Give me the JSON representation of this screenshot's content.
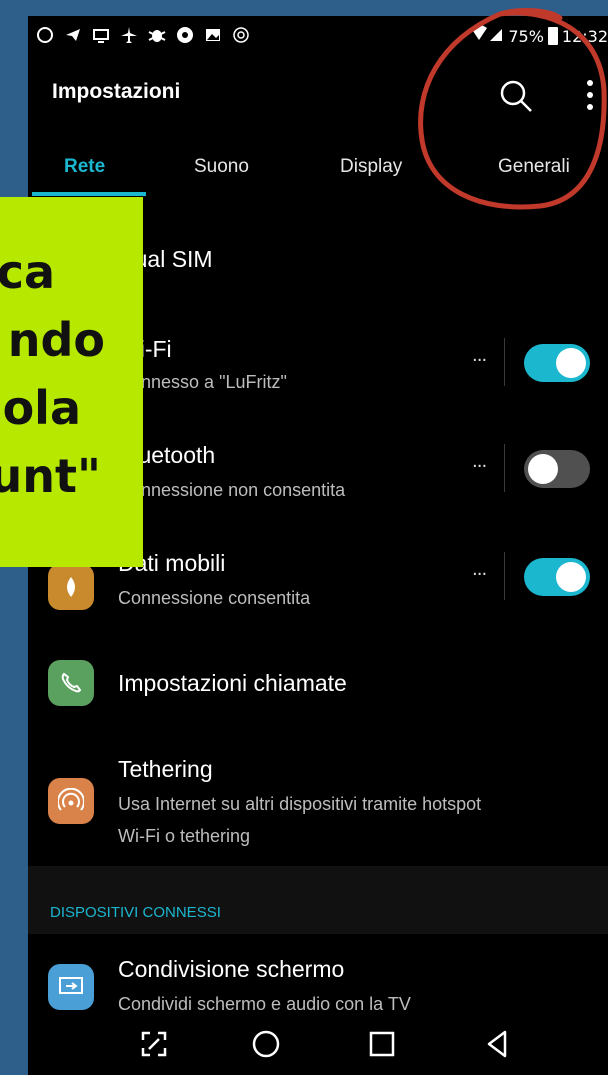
{
  "status_bar": {
    "left_icons": [
      "whatsapp-icon",
      "telegram-icon",
      "tv-icon",
      "airplane-icon",
      "bug-icon",
      "shield-icon",
      "image-icon",
      "at-icon"
    ],
    "battery": "75%",
    "time": "12:32"
  },
  "app_bar": {
    "title": "Impostazioni"
  },
  "tabs": [
    {
      "label": "Rete",
      "active": true
    },
    {
      "label": "Suono"
    },
    {
      "label": "Display"
    },
    {
      "label": "Generali"
    }
  ],
  "rows": {
    "dual_sim": {
      "title": "Dual SIM"
    },
    "wifi": {
      "title": "Wi-Fi",
      "subtitle": "Connesso a \"LuFritz\"",
      "toggle": "on"
    },
    "bluetooth": {
      "title": "Bluetooth",
      "subtitle": "Connessione non consentita",
      "toggle": "off"
    },
    "dati_mobili": {
      "title": "Dati mobili",
      "subtitle": "Connessione consentita",
      "toggle": "on"
    },
    "chiamate": {
      "title": "Impostazioni chiamate"
    },
    "tethering": {
      "title": "Tethering",
      "subtitle_1": "Usa Internet su altri dispositivi tramite hotspot",
      "subtitle_2": "Wi-Fi o tethering"
    },
    "condivisione": {
      "title": "Condivisione schermo",
      "subtitle": "Condividi schermo e audio con la TV"
    }
  },
  "more_dots": "···",
  "section": {
    "label": "DISPOSITIVI CONNESSI"
  },
  "nav": [
    "screenshot-icon",
    "home-icon",
    "recents-icon",
    "back-icon"
  ],
  "overlay_text": {
    "line1": "ca",
    "line2": "ndo",
    "line3": "ola",
    "line4": "unt\""
  },
  "colors": {
    "accent": "#1bb7cf",
    "sticker": "#b6e800",
    "circle": "#c0392b"
  }
}
